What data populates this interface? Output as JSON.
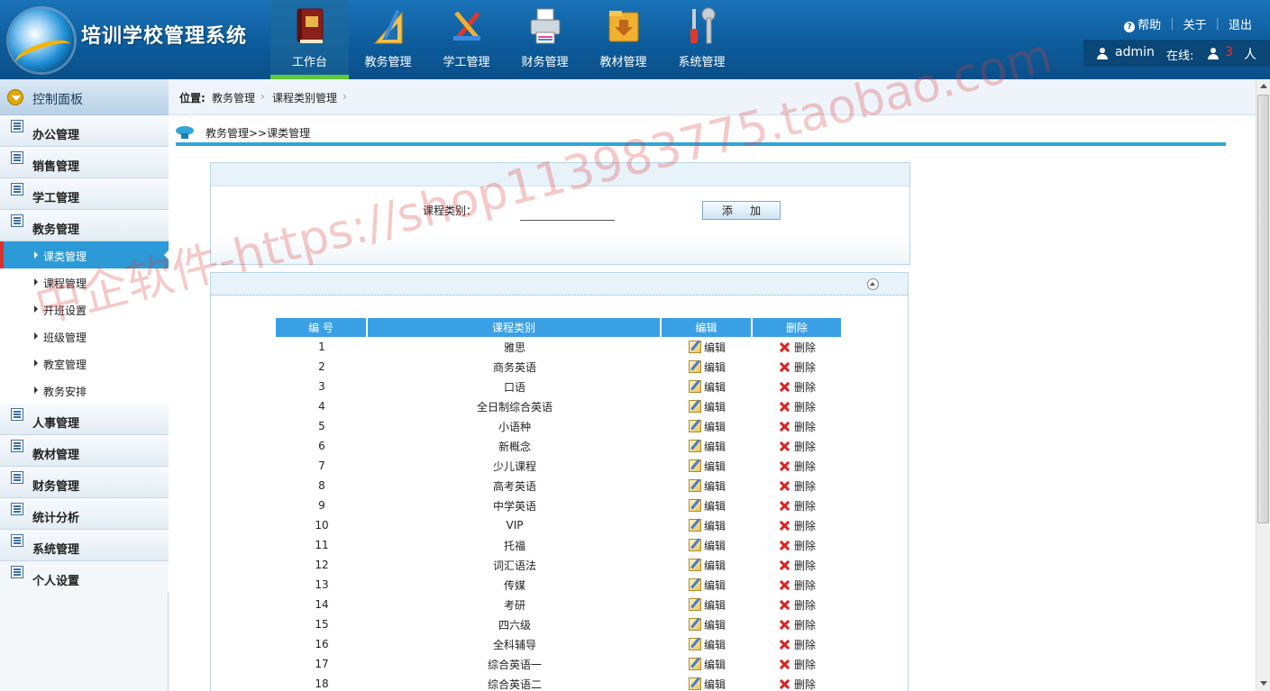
{
  "app": {
    "title": "培训学校管理系统"
  },
  "nav": [
    {
      "label": "工作台",
      "icon": "book-icon",
      "active": true
    },
    {
      "label": "教务管理",
      "icon": "ruler-icon",
      "active": false
    },
    {
      "label": "学工管理",
      "icon": "tools-icon",
      "active": false
    },
    {
      "label": "财务管理",
      "icon": "printer-icon",
      "active": false
    },
    {
      "label": "教材管理",
      "icon": "folder-icon",
      "active": false
    },
    {
      "label": "系统管理",
      "icon": "wrench-icon",
      "active": false
    }
  ],
  "top_links": {
    "help": "帮助",
    "about": "关于",
    "logout": "退出"
  },
  "user_bar": {
    "username": "admin",
    "online_label": "在线:",
    "online_count": "3",
    "online_unit": "人"
  },
  "sidebar": {
    "header": "控制面板",
    "menu": [
      {
        "label": "办公管理"
      },
      {
        "label": "销售管理"
      },
      {
        "label": "学工管理"
      },
      {
        "label": "教务管理"
      }
    ],
    "sub_items": [
      {
        "label": "课类管理",
        "active": true
      },
      {
        "label": "课程管理"
      },
      {
        "label": "开班设置"
      },
      {
        "label": "班级管理"
      },
      {
        "label": "教室管理"
      },
      {
        "label": "教务安排"
      }
    ],
    "menu_after": [
      {
        "label": "人事管理"
      },
      {
        "label": "教材管理"
      },
      {
        "label": "财务管理"
      },
      {
        "label": "统计分析"
      },
      {
        "label": "系统管理"
      },
      {
        "label": "个人设置"
      }
    ]
  },
  "breadcrumb": {
    "prefix": "位置:",
    "level1": "教务管理",
    "level2": "课程类别管理"
  },
  "section_title": "教务管理>>课类管理",
  "form": {
    "label": "课程类别：",
    "input_value": "",
    "add_button": "添 加"
  },
  "table": {
    "headers": [
      "编  号",
      "课程类别",
      "编辑",
      "删除"
    ],
    "edit_label": "编辑",
    "delete_label": "删除",
    "rows": [
      {
        "id": "1",
        "name": "雅思"
      },
      {
        "id": "2",
        "name": "商务英语"
      },
      {
        "id": "3",
        "name": "口语"
      },
      {
        "id": "4",
        "name": "全日制综合英语"
      },
      {
        "id": "5",
        "name": "小语种"
      },
      {
        "id": "6",
        "name": "新概念"
      },
      {
        "id": "7",
        "name": "少儿课程"
      },
      {
        "id": "8",
        "name": "高考英语"
      },
      {
        "id": "9",
        "name": "中学英语"
      },
      {
        "id": "10",
        "name": "VIP"
      },
      {
        "id": "11",
        "name": "托福"
      },
      {
        "id": "12",
        "name": "词汇语法"
      },
      {
        "id": "13",
        "name": "传媒"
      },
      {
        "id": "14",
        "name": "考研"
      },
      {
        "id": "15",
        "name": "四六级"
      },
      {
        "id": "16",
        "name": "全科辅导"
      },
      {
        "id": "17",
        "name": "综合英语一"
      },
      {
        "id": "18",
        "name": "综合英语二"
      }
    ]
  },
  "watermark": "中企软件-https://shop113983775.taobao.com",
  "colors": {
    "header_bg": "#0d5c9c",
    "accent": "#3aa0e6",
    "active_green": "#5fc93a",
    "active_red": "#d9302b"
  }
}
